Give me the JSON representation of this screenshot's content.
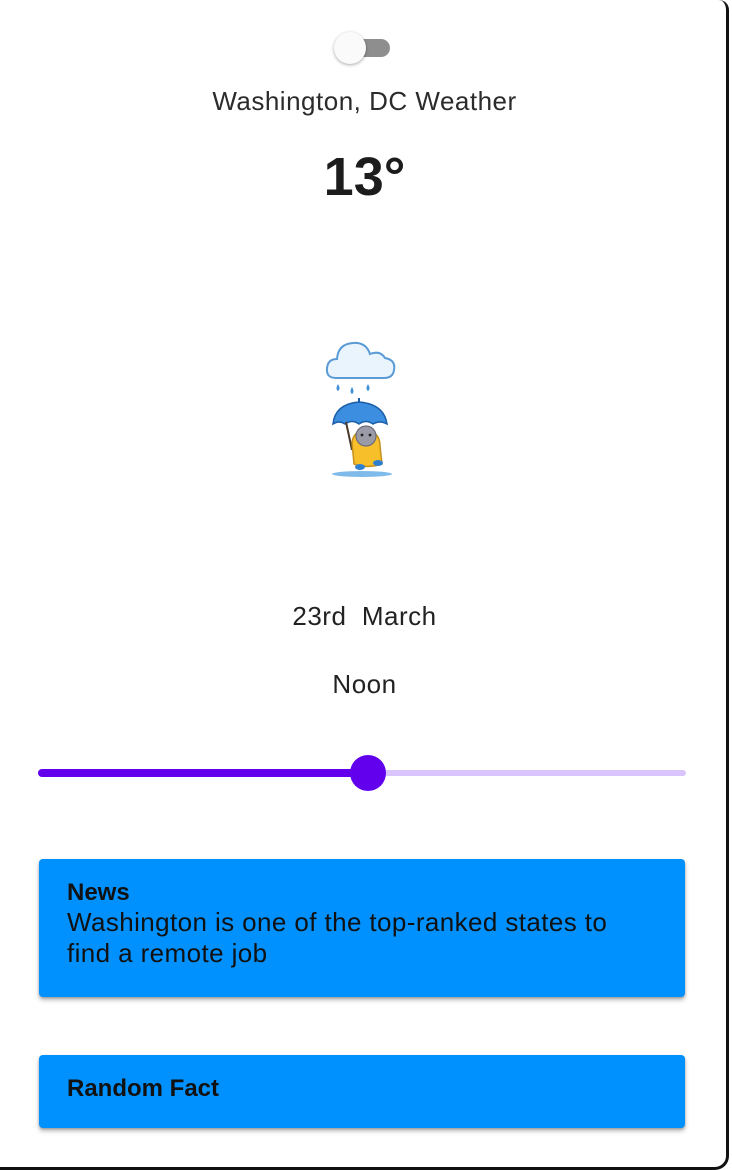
{
  "toggle": {
    "state": "off"
  },
  "header": {
    "title": "Washington, DC Weather",
    "temperature": "13°"
  },
  "illustration": {
    "icon": "rain-cloud-umbrella-character-icon"
  },
  "datetime": {
    "date": "23rd  March",
    "time": "Noon"
  },
  "slider": {
    "value_fraction": 0.51
  },
  "news_card": {
    "heading": "News",
    "body": "Washington is one of the top-ranked states to find a remote job"
  },
  "fact_card": {
    "heading": "Random Fact",
    "body": ""
  },
  "colors": {
    "accent": "#6200ee",
    "accent_light": "#d9c4fb",
    "card": "#0091ff"
  }
}
